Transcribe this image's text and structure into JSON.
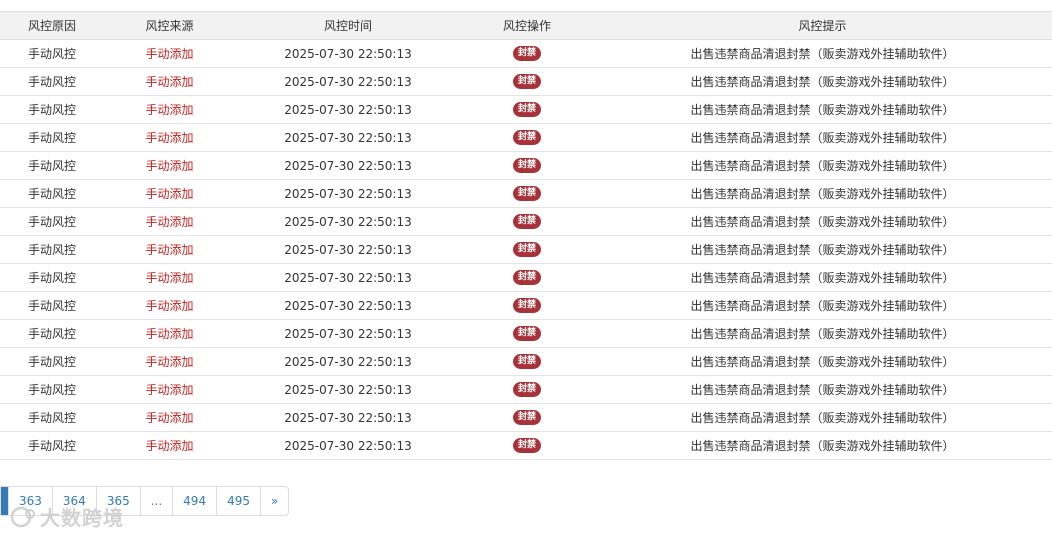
{
  "table": {
    "columns": [
      "风控原因",
      "风控来源",
      "风控时间",
      "风控操作",
      "风控提示"
    ],
    "rows": [
      {
        "reason": "手动风控",
        "source": "手动添加",
        "time": "2025-07-30 22:50:13",
        "action": "封禁",
        "hint": "出售违禁商品清退封禁（贩卖游戏外挂辅助软件）"
      },
      {
        "reason": "手动风控",
        "source": "手动添加",
        "time": "2025-07-30 22:50:13",
        "action": "封禁",
        "hint": "出售违禁商品清退封禁（贩卖游戏外挂辅助软件）"
      },
      {
        "reason": "手动风控",
        "source": "手动添加",
        "time": "2025-07-30 22:50:13",
        "action": "封禁",
        "hint": "出售违禁商品清退封禁（贩卖游戏外挂辅助软件）"
      },
      {
        "reason": "手动风控",
        "source": "手动添加",
        "time": "2025-07-30 22:50:13",
        "action": "封禁",
        "hint": "出售违禁商品清退封禁（贩卖游戏外挂辅助软件）"
      },
      {
        "reason": "手动风控",
        "source": "手动添加",
        "time": "2025-07-30 22:50:13",
        "action": "封禁",
        "hint": "出售违禁商品清退封禁（贩卖游戏外挂辅助软件）"
      },
      {
        "reason": "手动风控",
        "source": "手动添加",
        "time": "2025-07-30 22:50:13",
        "action": "封禁",
        "hint": "出售违禁商品清退封禁（贩卖游戏外挂辅助软件）"
      },
      {
        "reason": "手动风控",
        "source": "手动添加",
        "time": "2025-07-30 22:50:13",
        "action": "封禁",
        "hint": "出售违禁商品清退封禁（贩卖游戏外挂辅助软件）"
      },
      {
        "reason": "手动风控",
        "source": "手动添加",
        "time": "2025-07-30 22:50:13",
        "action": "封禁",
        "hint": "出售违禁商品清退封禁（贩卖游戏外挂辅助软件）"
      },
      {
        "reason": "手动风控",
        "source": "手动添加",
        "time": "2025-07-30 22:50:13",
        "action": "封禁",
        "hint": "出售违禁商品清退封禁（贩卖游戏外挂辅助软件）"
      },
      {
        "reason": "手动风控",
        "source": "手动添加",
        "time": "2025-07-30 22:50:13",
        "action": "封禁",
        "hint": "出售违禁商品清退封禁（贩卖游戏外挂辅助软件）"
      },
      {
        "reason": "手动风控",
        "source": "手动添加",
        "time": "2025-07-30 22:50:13",
        "action": "封禁",
        "hint": "出售违禁商品清退封禁（贩卖游戏外挂辅助软件）"
      },
      {
        "reason": "手动风控",
        "source": "手动添加",
        "time": "2025-07-30 22:50:13",
        "action": "封禁",
        "hint": "出售违禁商品清退封禁（贩卖游戏外挂辅助软件）"
      },
      {
        "reason": "手动风控",
        "source": "手动添加",
        "time": "2025-07-30 22:50:13",
        "action": "封禁",
        "hint": "出售违禁商品清退封禁（贩卖游戏外挂辅助软件）"
      },
      {
        "reason": "手动风控",
        "source": "手动添加",
        "time": "2025-07-30 22:50:13",
        "action": "封禁",
        "hint": "出售违禁商品清退封禁（贩卖游戏外挂辅助软件）"
      },
      {
        "reason": "手动风控",
        "source": "手动添加",
        "time": "2025-07-30 22:50:13",
        "action": "封禁",
        "hint": "出售违禁商品清退封禁（贩卖游戏外挂辅助软件）"
      }
    ]
  },
  "pagination": {
    "pages": [
      "363",
      "364",
      "365",
      "...",
      "494",
      "495",
      "»"
    ]
  },
  "watermark": {
    "text": "大数跨境",
    "icon": "brand-logo-icon"
  },
  "colors": {
    "source_text": "#cc1f1f",
    "badge_bg": "#a8323a",
    "page_link": "#337ab7",
    "header_bg": "#f2f2f2"
  }
}
